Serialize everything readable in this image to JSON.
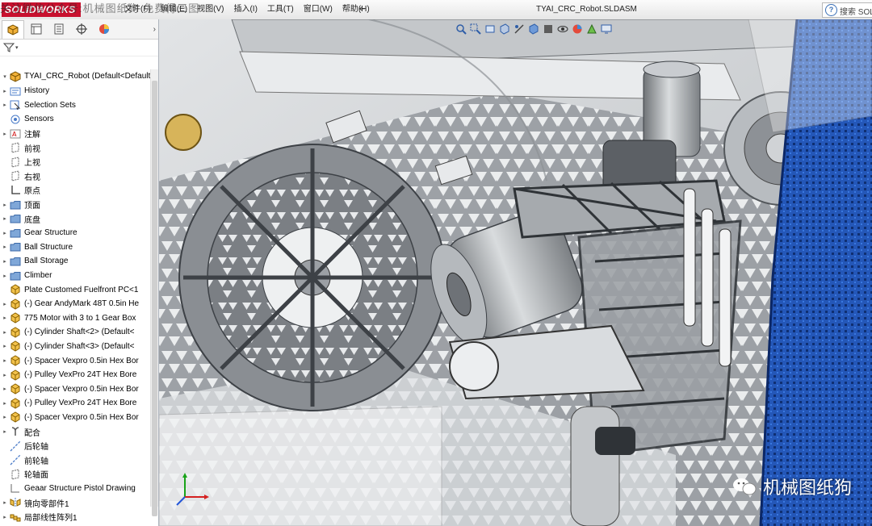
{
  "titlebar": {
    "logo": "SOLIDWORKS",
    "watermark_overlay": "关注微信公众号:机械图纸狗 免费得三图",
    "menu": [
      "文件(F)",
      "编辑(E)",
      "视图(V)",
      "插入(I)",
      "工具(T)",
      "窗口(W)",
      "帮助(H)"
    ],
    "pin": "⇤",
    "document_title": "TYAI_CRC_Robot.SLDASM",
    "search_label": "搜索 SOLI"
  },
  "feature_tree": {
    "root": "TYAI_CRC_Robot  (Default<Default_",
    "items": [
      {
        "label": "History",
        "icon": "history-icon",
        "expand": true
      },
      {
        "label": "Selection Sets",
        "icon": "selection-sets-icon",
        "expand": true
      },
      {
        "label": "Sensors",
        "icon": "sensors-icon",
        "expand": false
      },
      {
        "label": "注解",
        "icon": "annotations-icon",
        "expand": true
      },
      {
        "label": "前视",
        "icon": "plane-icon",
        "expand": false
      },
      {
        "label": "上视",
        "icon": "plane-icon",
        "expand": false
      },
      {
        "label": "右视",
        "icon": "plane-icon",
        "expand": false
      },
      {
        "label": "原点",
        "icon": "origin-icon",
        "expand": false
      },
      {
        "label": "顶面",
        "icon": "folder-icon",
        "expand": true
      },
      {
        "label": "底盘",
        "icon": "folder-icon",
        "expand": true
      },
      {
        "label": "Gear Structure",
        "icon": "folder-icon",
        "expand": true
      },
      {
        "label": "Ball Structure",
        "icon": "folder-icon",
        "expand": true
      },
      {
        "label": "Ball Storage",
        "icon": "folder-icon",
        "expand": true
      },
      {
        "label": "Climber",
        "icon": "folder-icon",
        "expand": true
      },
      {
        "label": "Plate Customed Fuelfront PC<1",
        "icon": "part-icon",
        "expand": false
      },
      {
        "label": "(-) Gear AndyMark 48T 0.5in He",
        "icon": "part-icon",
        "expand": true
      },
      {
        "label": "775 Motor with 3 to 1 Gear Box",
        "icon": "part-icon",
        "expand": true
      },
      {
        "label": "(-) Cylinder Shaft<2> (Default<",
        "icon": "part-icon",
        "expand": true
      },
      {
        "label": "(-) Cylinder Shaft<3> (Default<",
        "icon": "part-icon",
        "expand": true
      },
      {
        "label": "(-) Spacer Vexpro 0.5in Hex Bor",
        "icon": "part-icon",
        "expand": true
      },
      {
        "label": "(-) Pulley VexPro 24T Hex Bore",
        "icon": "part-icon",
        "expand": true
      },
      {
        "label": "(-) Spacer Vexpro 0.5in Hex Bor",
        "icon": "part-icon",
        "expand": true
      },
      {
        "label": "(-) Pulley VexPro 24T Hex Bore",
        "icon": "part-icon",
        "expand": true
      },
      {
        "label": "(-) Spacer Vexpro 0.5in Hex Bor",
        "icon": "part-icon",
        "expand": true
      },
      {
        "label": "配合",
        "icon": "mates-icon",
        "expand": true
      },
      {
        "label": "后轮轴",
        "icon": "axis-icon",
        "expand": false
      },
      {
        "label": "前轮轴",
        "icon": "axis-icon",
        "expand": false
      },
      {
        "label": "轮轴面",
        "icon": "plane-icon",
        "expand": false
      },
      {
        "label": "Geaar Structure Pistol Drawing",
        "icon": "sketch-icon",
        "expand": false
      },
      {
        "label": "镜向零部件1",
        "icon": "mirror-icon",
        "expand": true
      },
      {
        "label": "局部线性阵列1",
        "icon": "pattern-icon",
        "expand": true
      }
    ]
  },
  "viewport": {
    "brand_text": "机械图纸狗"
  },
  "colors": {
    "brand_red": "#c8102e",
    "frame_blue": "#1d4fa8",
    "metal_grey": "#8a8e93"
  }
}
